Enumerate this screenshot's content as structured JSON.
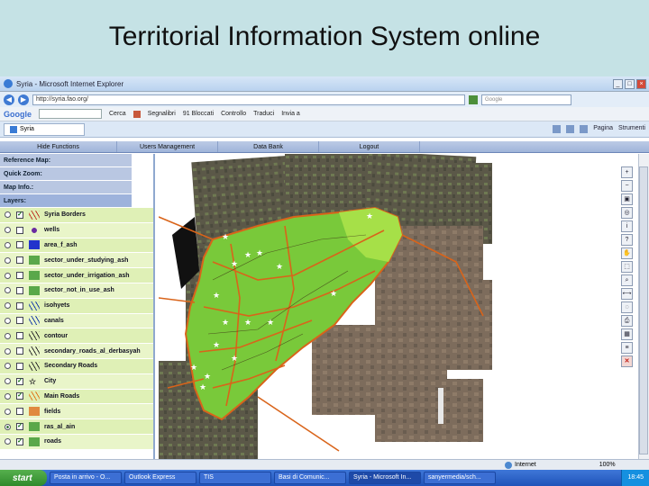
{
  "slide_title": "Territorial Information System online",
  "browser": {
    "window_title": "Syria - Microsoft Internet Explorer",
    "address": "http://syria.fao.org/",
    "search_placeholder": "Google",
    "google_label": "Google",
    "toolbar_items": [
      "Cerca",
      "Segnalibri",
      "91 Bloccati",
      "Controllo",
      "Traduci",
      "Invia a"
    ],
    "tab_label": "Syria",
    "tab_tools": [
      "Pagina",
      "Strumenti"
    ],
    "status_zone": "Internet",
    "status_zoom": "100%"
  },
  "app_menu": [
    "Hide Functions",
    "Users Management",
    "Data Bank",
    "Logout"
  ],
  "left_panel": {
    "sections": [
      "Reference Map:",
      "Quick Zoom:",
      "Map Info.:",
      "Layers:"
    ],
    "layers": [
      {
        "name": "Syria Borders",
        "checked": true,
        "selected": false,
        "icon": "red-lines",
        "color": "#c0392b"
      },
      {
        "name": "wells",
        "checked": false,
        "selected": false,
        "icon": "purple-dot",
        "color": "#6a2ca0"
      },
      {
        "name": "area_f_ash",
        "checked": false,
        "selected": false,
        "icon": "blue-square",
        "color": "#2233cc"
      },
      {
        "name": "sector_under_studying_ash",
        "checked": false,
        "selected": false,
        "icon": "green-square",
        "color": "#5aa84a"
      },
      {
        "name": "sector_under_irrigation_ash",
        "checked": false,
        "selected": false,
        "icon": "green-square",
        "color": "#5aa84a"
      },
      {
        "name": "sector_not_in_use_ash",
        "checked": false,
        "selected": false,
        "icon": "green-square",
        "color": "#5aa84a"
      },
      {
        "name": "isohyets",
        "checked": false,
        "selected": false,
        "icon": "blue-lines",
        "color": "#2244aa"
      },
      {
        "name": "canals",
        "checked": false,
        "selected": false,
        "icon": "blue-lines",
        "color": "#2244aa"
      },
      {
        "name": "contour",
        "checked": false,
        "selected": false,
        "icon": "dark-lines",
        "color": "#333333"
      },
      {
        "name": "secondary_roads_al_derbasyah",
        "checked": false,
        "selected": false,
        "icon": "dark-lines",
        "color": "#333333"
      },
      {
        "name": "Secondary Roads",
        "checked": false,
        "selected": false,
        "icon": "dark-lines",
        "color": "#333333"
      },
      {
        "name": "City",
        "checked": true,
        "selected": false,
        "icon": "star",
        "color": "#ffffff"
      },
      {
        "name": "Main Roads",
        "checked": true,
        "selected": false,
        "icon": "orange-lines",
        "color": "#e07a20"
      },
      {
        "name": "fields",
        "checked": false,
        "selected": false,
        "icon": "orange-square",
        "color": "#e08a40"
      },
      {
        "name": "ras_al_ain",
        "checked": true,
        "selected": true,
        "icon": "green-square",
        "color": "#5aa84a"
      },
      {
        "name": "roads",
        "checked": true,
        "selected": false,
        "icon": "green-square",
        "color": "#5aa84a"
      }
    ]
  },
  "map_tools": [
    "zoom-in-icon",
    "zoom-out-icon",
    "full-extent-icon",
    "globe-icon",
    "info-icon",
    "identify-icon",
    "pan-icon",
    "select-icon",
    "query-icon",
    "measure-icon",
    "buffer-icon",
    "print-icon",
    "table-icon",
    "legend-icon",
    "close-icon"
  ],
  "map_tool_glyphs": [
    "+",
    "−",
    "▣",
    "◎",
    "i",
    "?",
    "✋",
    "⬚",
    "⌕",
    "⟷",
    "◌",
    "⎙",
    "▦",
    "≡",
    "✕"
  ],
  "taskbar": {
    "start": "start",
    "tasks": [
      "Posta in arrivo - O...",
      "Outlook Express",
      "TIS",
      "Basi di Comunic...",
      "Syria - Microsoft In...",
      "sanyermedia/sch..."
    ],
    "clock": "18:45"
  }
}
